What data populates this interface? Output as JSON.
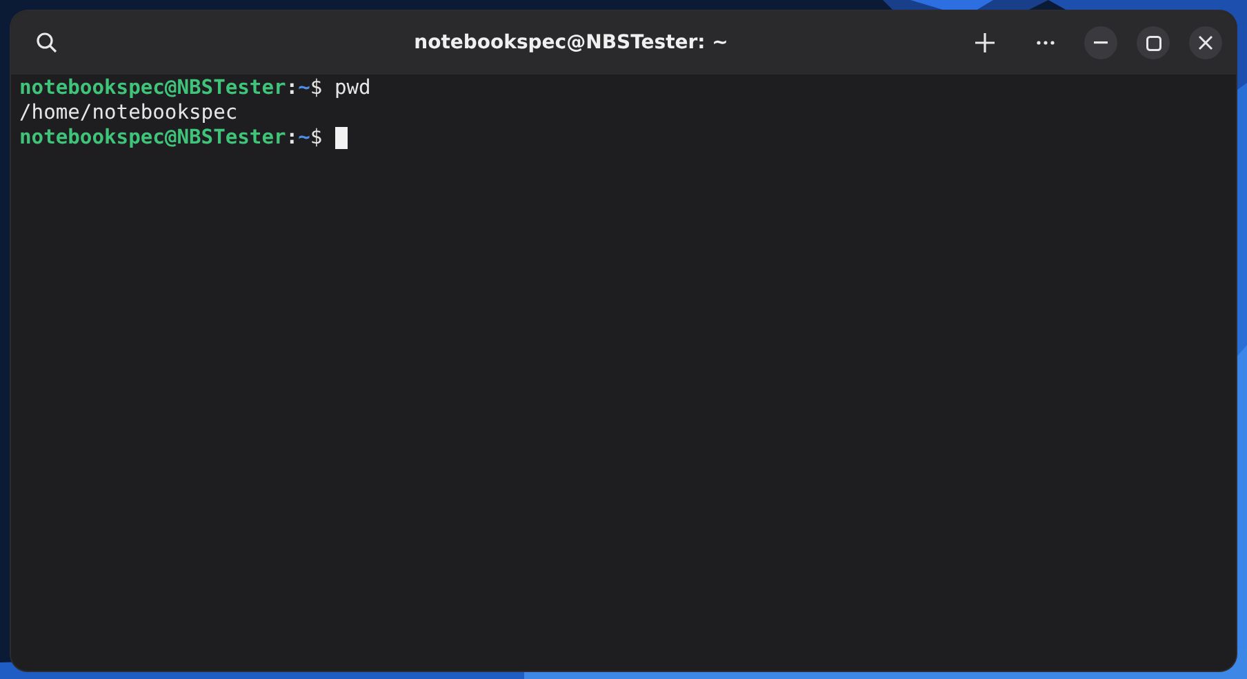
{
  "window": {
    "title": "notebookspec@NBSTester: ~"
  },
  "terminal": {
    "lines": [
      {
        "kind": "prompt",
        "user_host": "notebookspec@NBSTester",
        "separator": ":",
        "path": "~",
        "symbol": "$",
        "command": "pwd",
        "cursor": false
      },
      {
        "kind": "output",
        "text": "/home/notebookspec"
      },
      {
        "kind": "prompt",
        "user_host": "notebookspec@NBSTester",
        "separator": ":",
        "path": "~",
        "symbol": "$",
        "cursor": true
      }
    ]
  }
}
